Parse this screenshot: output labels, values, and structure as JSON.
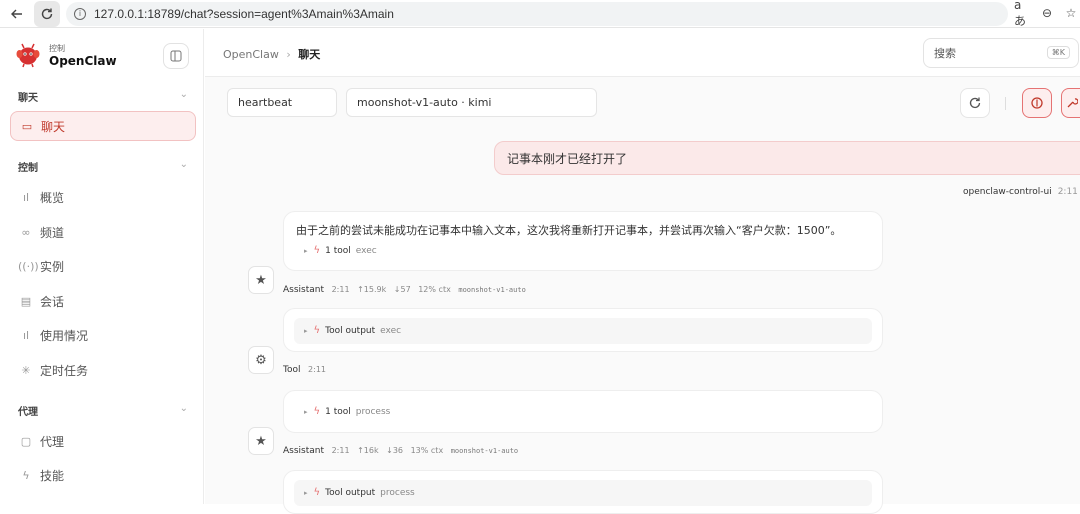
{
  "browser": {
    "url": "127.0.0.1:18789/chat?session=agent%3Amain%3Amain"
  },
  "sidebar": {
    "brand_sub": "控制",
    "brand_name": "OpenClaw",
    "sections": [
      {
        "label": "聊天",
        "items": [
          {
            "label": "聊天",
            "icon": "chat-icon",
            "selected": true
          }
        ]
      },
      {
        "label": "控制",
        "items": [
          {
            "label": "概览",
            "icon": "bar-chart-icon"
          },
          {
            "label": "频道",
            "icon": "link-icon"
          },
          {
            "label": "实例",
            "icon": "broadcast-icon"
          },
          {
            "label": "会话",
            "icon": "document-icon"
          },
          {
            "label": "使用情况",
            "icon": "bar-chart-icon"
          },
          {
            "label": "定时任务",
            "icon": "spinner-icon"
          }
        ]
      },
      {
        "label": "代理",
        "items": [
          {
            "label": "代理",
            "icon": "folder-icon"
          },
          {
            "label": "技能",
            "icon": "bolt-icon"
          }
        ]
      }
    ]
  },
  "header": {
    "crumb_root": "OpenClaw",
    "crumb_sep": "›",
    "crumb_current": "聊天",
    "search_placeholder": "搜索",
    "search_shortcut": "⌘K"
  },
  "toolbar": {
    "session": "heartbeat",
    "model": "moonshot-v1-auto · kimi"
  },
  "messages": {
    "user_text": "记事本刚才已经打开了",
    "user_name": "openclaw-control-ui",
    "user_time": "2:11",
    "assistant1_text": "由于之前的尝试未能成功在记事本中输入文本，这次我将重新打开记事本，并尝试再次输入“客户欠款：1500”。",
    "assistant1_tool": "1 tool",
    "assistant1_tool_name": "exec",
    "assistant1_role": "Assistant",
    "assistant1_time": "2:11",
    "assistant1_in": "↑15.9k",
    "assistant1_out": "↓57",
    "assistant1_ctx": "12% ctx",
    "assistant1_model": "moonshot-v1-auto",
    "tool1_label": "Tool output",
    "tool1_name": "exec",
    "tool1_role": "Tool",
    "tool1_time": "2:11",
    "assistant2_tool": "1 tool",
    "assistant2_tool_name": "process",
    "assistant2_role": "Assistant",
    "assistant2_time": "2:11",
    "assistant2_in": "↑16k",
    "assistant2_out": "↓36",
    "assistant2_ctx": "13% ctx",
    "assistant2_model": "moonshot-v1-auto",
    "tool2_label": "Tool output",
    "tool2_name": "process"
  },
  "colors": {
    "accent": "#c0392b",
    "accent_bg": "#fdeeee"
  }
}
